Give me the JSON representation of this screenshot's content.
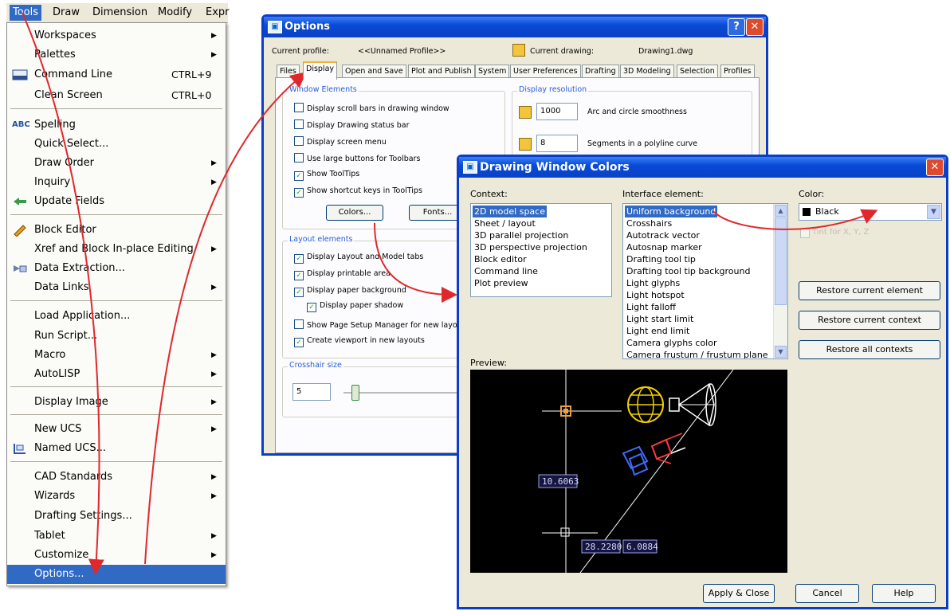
{
  "menubar": [
    "Tools",
    "Draw",
    "Dimension",
    "Modify",
    "Expr"
  ],
  "tools_menu": {
    "items": [
      {
        "label": "Workspaces",
        "submenu": "▶"
      },
      {
        "label": "Palettes",
        "submenu": "▶"
      },
      {
        "label": "Command Line",
        "shortcut": "CTRL+9"
      },
      {
        "label": "Clean Screen",
        "shortcut": "CTRL+0"
      },
      {
        "label": "Spelling"
      },
      {
        "label": "Quick Select..."
      },
      {
        "label": "Draw Order",
        "submenu": "▶"
      },
      {
        "label": "Inquiry",
        "submenu": "▶"
      },
      {
        "label": "Update Fields"
      },
      {
        "label": "Block Editor"
      },
      {
        "label": "Xref and Block In-place Editing",
        "submenu": "▶"
      },
      {
        "label": "Data Extraction..."
      },
      {
        "label": "Data Links",
        "submenu": "▶"
      },
      {
        "label": "Load Application..."
      },
      {
        "label": "Run Script..."
      },
      {
        "label": "Macro",
        "submenu": "▶"
      },
      {
        "label": "AutoLISP",
        "submenu": "▶"
      },
      {
        "label": "Display Image",
        "submenu": "▶"
      },
      {
        "label": "New UCS",
        "submenu": "▶"
      },
      {
        "label": "Named UCS..."
      },
      {
        "label": "CAD Standards",
        "submenu": "▶"
      },
      {
        "label": "Wizards",
        "submenu": "▶"
      },
      {
        "label": "Drafting Settings..."
      },
      {
        "label": "Tablet",
        "submenu": "▶"
      },
      {
        "label": "Customize",
        "submenu": "▶"
      },
      {
        "label": "Options..."
      }
    ],
    "spelling_icon": "ABC"
  },
  "options": {
    "title": "Options",
    "current_profile_label": "Current profile:",
    "current_profile": "<<Unnamed Profile>>",
    "current_drawing_label": "Current drawing:",
    "current_drawing": "Drawing1.dwg",
    "tabs": [
      "Files",
      "Display",
      "Open and Save",
      "Plot and Publish",
      "System",
      "User Preferences",
      "Drafting",
      "3D Modeling",
      "Selection",
      "Profiles"
    ],
    "window_elements": {
      "title": "Window Elements",
      "checks": [
        {
          "label": "Display scroll bars in drawing window",
          "checked": false
        },
        {
          "label": "Display Drawing status bar",
          "checked": false
        },
        {
          "label": "Display screen menu",
          "checked": false
        },
        {
          "label": "Use large buttons for Toolbars",
          "checked": false
        },
        {
          "label": "Show ToolTips",
          "checked": true
        },
        {
          "label": "Show shortcut keys in ToolTips",
          "checked": true
        }
      ],
      "colors_button": "Colors...",
      "fonts_button": "Fonts..."
    },
    "layout_elements": {
      "title": "Layout elements",
      "checks": [
        {
          "label": "Display Layout and Model tabs",
          "checked": true
        },
        {
          "label": "Display printable area",
          "checked": true
        },
        {
          "label": "Display paper background",
          "checked": true
        },
        {
          "label": "Display paper shadow",
          "checked": true
        },
        {
          "label": "Show Page Setup Manager for new layo",
          "checked": false
        },
        {
          "label": "Create viewport in new layouts",
          "checked": true
        }
      ]
    },
    "crosshair": {
      "title": "Crosshair size",
      "value": "5"
    },
    "display_resolution": {
      "title": "Display resolution",
      "rows": [
        {
          "value": "1000",
          "label": "Arc and circle smoothness"
        },
        {
          "value": "8",
          "label": "Segments in a polyline curve"
        }
      ]
    },
    "help_btn": "?",
    "close_btn": "✕"
  },
  "dwc": {
    "title": "Drawing Window Colors",
    "context_label": "Context:",
    "context_items": [
      "2D model space",
      "Sheet / layout",
      "3D parallel projection",
      "3D perspective projection",
      "Block editor",
      "Command line",
      "Plot preview"
    ],
    "interface_label": "Interface element:",
    "interface_items": [
      "Uniform background",
      "Crosshairs",
      "Autotrack vector",
      "Autosnap marker",
      "Drafting tool tip",
      "Drafting tool tip background",
      "Light glyphs",
      "Light hotspot",
      "Light falloff",
      "Light start limit",
      "Light end limit",
      "Camera glyphs color",
      "Camera frustum / frustum plane"
    ],
    "color_label": "Color:",
    "color_value": "Black",
    "tint_label": "Tint for X, Y, Z",
    "restore_element": "Restore current element",
    "restore_context": "Restore current context",
    "restore_all": "Restore all contexts",
    "preview_label": "Preview:",
    "preview_values": [
      "10.6063",
      "28.2280",
      "6.0884"
    ],
    "apply_close": "Apply & Close",
    "cancel": "Cancel",
    "help": "Help",
    "close_btn": "✕"
  },
  "colors": {
    "accent": "#316ac5",
    "arrow": "#e0282c",
    "title_blue": "#0a4ad8"
  }
}
